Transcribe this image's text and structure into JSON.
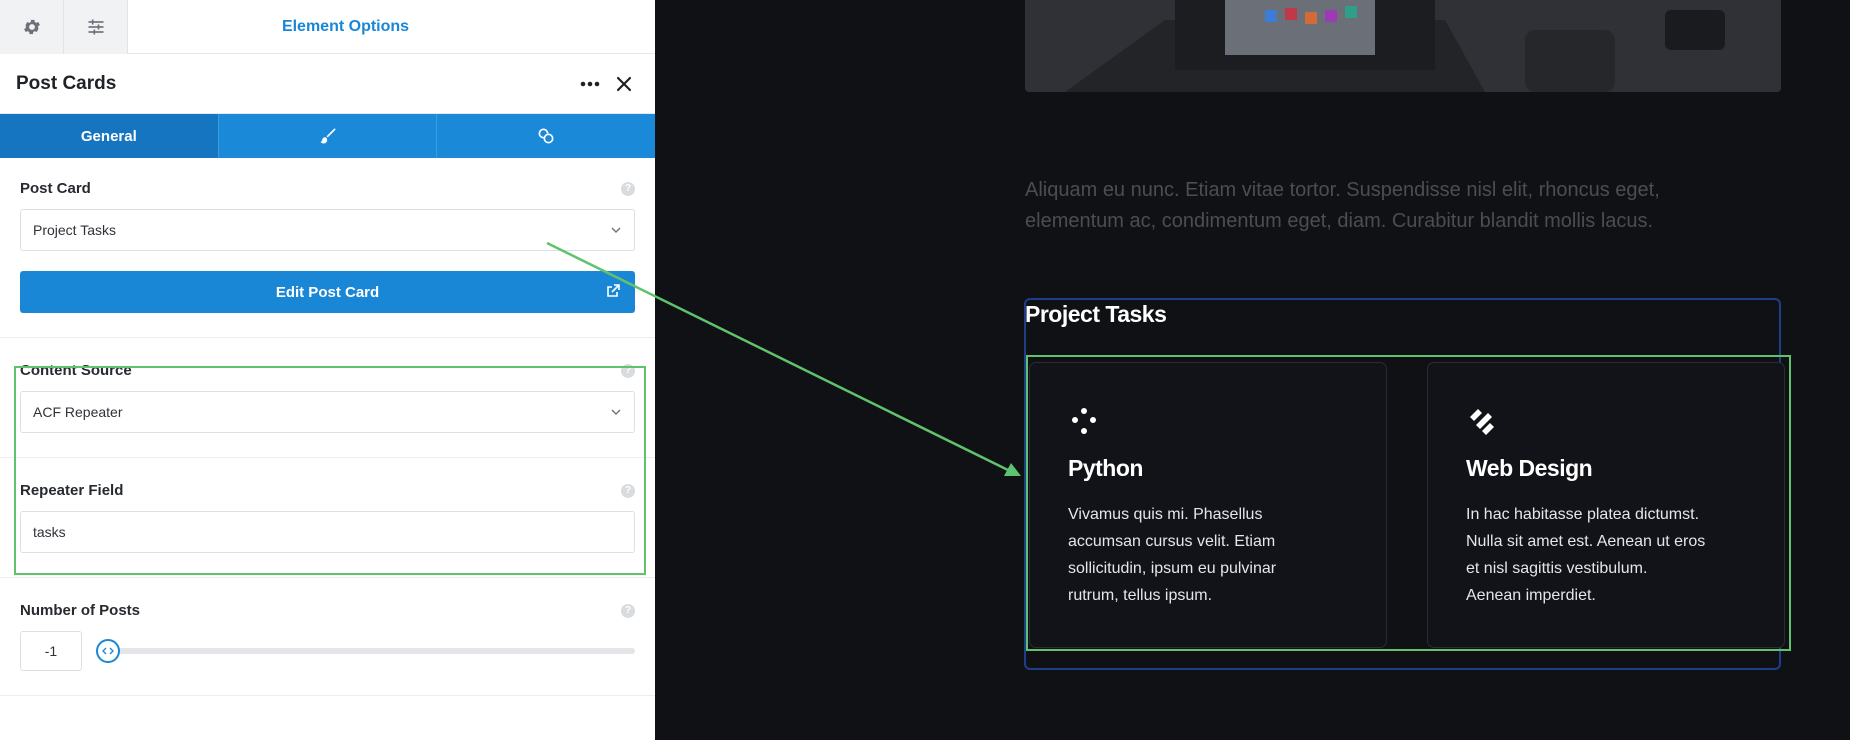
{
  "topbar": {
    "title": "Element Options",
    "settings_icon": "gear-icon",
    "options_icon": "sliders-icon"
  },
  "header": {
    "title": "Post Cards",
    "more_icon": "more-icon",
    "close_icon": "close-icon"
  },
  "tabs": [
    {
      "label": "General",
      "active": true
    },
    {
      "label": "",
      "icon": "brush-icon"
    },
    {
      "label": "",
      "icon": "link-icon"
    }
  ],
  "fields": {
    "post_card": {
      "label": "Post Card",
      "value": "Project Tasks"
    },
    "edit_button": {
      "label": "Edit Post Card"
    },
    "content_source": {
      "label": "Content Source",
      "value": "ACF Repeater"
    },
    "repeater_field": {
      "label": "Repeater Field",
      "value": "tasks"
    },
    "number_of_posts": {
      "label": "Number of Posts",
      "value": "-1"
    }
  },
  "canvas": {
    "lead_text": "Aliquam eu nunc. Etiam vitae tortor. Suspendisse nisl elit, rhoncus eget, elementum ac, condimentum eget, diam. Curabitur blandit mollis lacus.",
    "section_title": "Project Tasks",
    "cards": [
      {
        "title": "Python",
        "text": "Vivamus quis mi. Phasellus accumsan cursus velit. Etiam sollicitudin, ipsum eu pulvinar rutrum, tellus ipsum.",
        "icon": "dots-icon"
      },
      {
        "title": "Web Design",
        "text": "In hac habitasse platea dictumst. Nulla sit amet est. Aenean ut eros et nisl sagittis vestibulum. Aenean imperdiet.",
        "icon": "design-icon"
      }
    ]
  },
  "colors": {
    "accent": "#1a87d6",
    "highlight": "#5fc36e",
    "frame": "#1d3f8a"
  }
}
